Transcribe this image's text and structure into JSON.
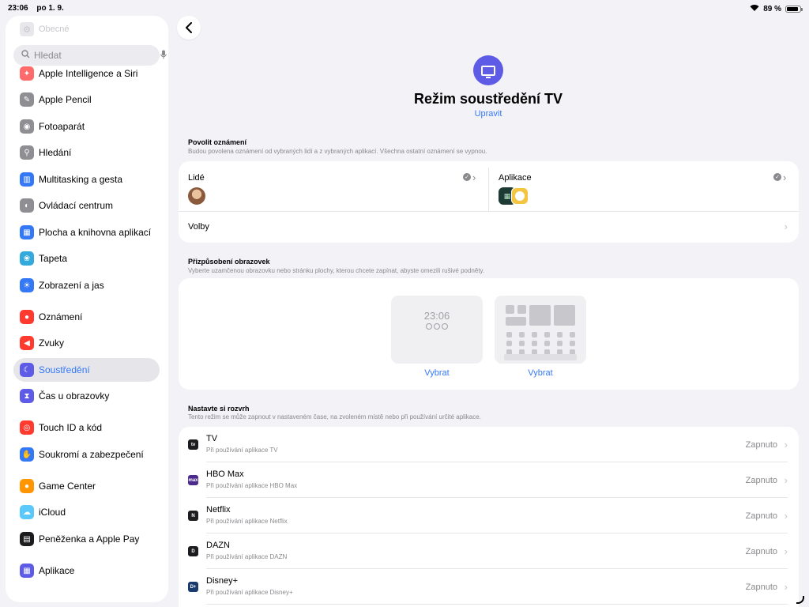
{
  "status": {
    "time": "23:06",
    "date": "po 1. 9.",
    "battery": "89 %",
    "battery_level": 0.89
  },
  "sidebar": {
    "faded_item": "Obecné",
    "search_placeholder": "Hledat",
    "items": [
      {
        "label": "Apple Intelligence a Siri",
        "icon": "siri-icon",
        "color": "#ff6b6b"
      },
      {
        "label": "Apple Pencil",
        "icon": "pencil-icon",
        "color": "#8e8e93"
      },
      {
        "label": "Fotoaparát",
        "icon": "camera-icon",
        "color": "#8e8e93"
      },
      {
        "label": "Hledání",
        "icon": "search-icon",
        "color": "#8e8e93"
      },
      {
        "label": "Multitasking a gesta",
        "icon": "multitasking-icon",
        "color": "#3478f6"
      },
      {
        "label": "Ovládací centrum",
        "icon": "control-center-icon",
        "color": "#8e8e93"
      },
      {
        "label": "Plocha a knihovna aplikací",
        "icon": "home-screen-icon",
        "color": "#3478f6"
      },
      {
        "label": "Tapeta",
        "icon": "wallpaper-icon",
        "color": "#34aadc"
      },
      {
        "label": "Zobrazení a jas",
        "icon": "brightness-icon",
        "color": "#3478f6"
      },
      {
        "label": "Oznámení",
        "icon": "notifications-icon",
        "color": "#ff3b30"
      },
      {
        "label": "Zvuky",
        "icon": "sounds-icon",
        "color": "#ff3b30"
      },
      {
        "label": "Soustředění",
        "icon": "focus-moon-icon",
        "color": "#5e5ce6"
      },
      {
        "label": "Čas u obrazovky",
        "icon": "screen-time-icon",
        "color": "#5e5ce6"
      },
      {
        "label": "Touch ID a kód",
        "icon": "touch-id-icon",
        "color": "#ff3b30"
      },
      {
        "label": "Soukromí a zabezpečení",
        "icon": "privacy-hand-icon",
        "color": "#3478f6"
      },
      {
        "label": "Game Center",
        "icon": "game-center-icon",
        "color": "#ff9500"
      },
      {
        "label": "iCloud",
        "icon": "icloud-icon",
        "color": "#5ac8fa"
      },
      {
        "label": "Peněženka a Apple Pay",
        "icon": "wallet-icon",
        "color": "#1c1c1e"
      },
      {
        "label": "Aplikace",
        "icon": "apps-icon",
        "color": "#5e5ce6"
      }
    ]
  },
  "main": {
    "title": "Režim soustředění TV",
    "edit": "Upravit",
    "allow_header": "Povolit oznámení",
    "allow_sub": "Budou povolena oznámení od vybraných lidí a z vybraných aplikací. Všechna ostatní oznámení se vypnou.",
    "people": "Lidé",
    "apps": "Aplikace",
    "options": "Volby",
    "screens_header": "Přizpůsobení obrazovek",
    "screens_sub": "Vyberte uzamčenou obrazovku nebo stránku plochy, kterou chcete zapínat, abyste omezili rušivé podněty.",
    "lock_time": "23:06",
    "choose": "Vybrat",
    "schedule_header": "Nastavte si rozvrh",
    "schedule_sub": "Tento režim se může zapnout v nastaveném čase, na zvoleném místě nebo při používání určité aplikace.",
    "schedule": [
      {
        "name": "TV",
        "sub": "Při používání aplikace TV",
        "state": "Zapnuto",
        "icon": "apple-tv-icon",
        "color": "#1c1c1e",
        "glyph": "tv"
      },
      {
        "name": "HBO Max",
        "sub": "Při používání aplikace HBO Max",
        "state": "Zapnuto",
        "icon": "hbo-max-icon",
        "color": "#4b2a8c",
        "glyph": "max"
      },
      {
        "name": "Netflix",
        "sub": "Při používání aplikace Netflix",
        "state": "Zapnuto",
        "icon": "netflix-icon",
        "color": "#1c1c1e",
        "glyph": "N"
      },
      {
        "name": "DAZN",
        "sub": "Při používání aplikace DAZN",
        "state": "Zapnuto",
        "icon": "dazn-icon",
        "color": "#1c1c1e",
        "glyph": "D"
      },
      {
        "name": "Disney+",
        "sub": "Při používání aplikace Disney+",
        "state": "Zapnuto",
        "icon": "disney-plus-icon",
        "color": "#1a3b6e",
        "glyph": "D+"
      }
    ]
  }
}
